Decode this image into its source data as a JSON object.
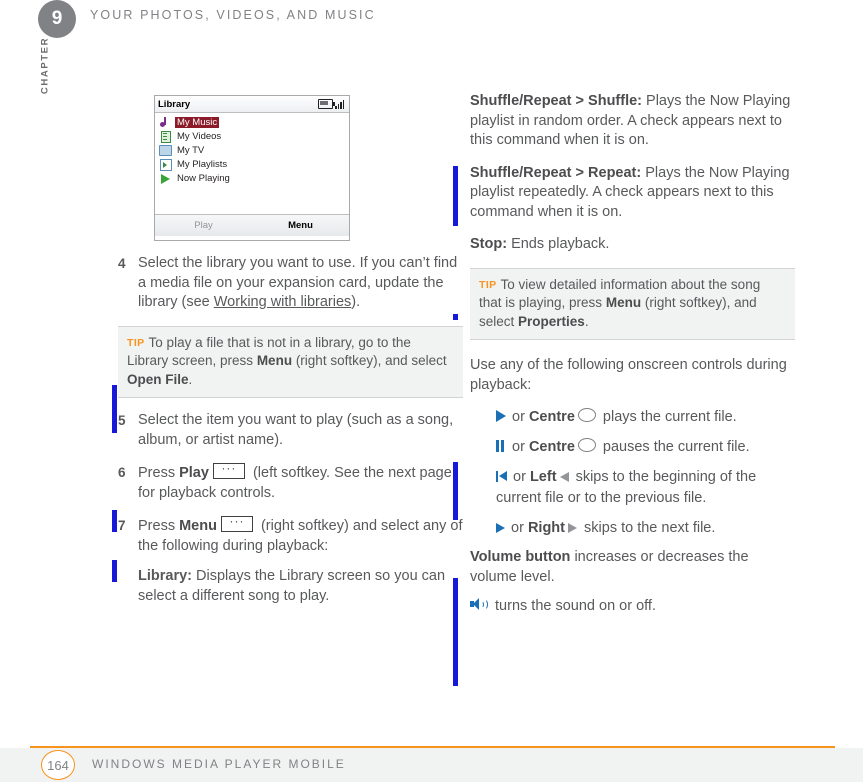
{
  "header": {
    "chapter_number": "9",
    "title": "YOUR PHOTOS, VIDEOS, AND MUSIC",
    "chapter_word": "CHAPTER"
  },
  "phone_screen": {
    "title": "Library",
    "status_icons": [
      "battery-icon",
      "signal-icon"
    ],
    "items": [
      {
        "label": "My Music",
        "icon": "music-note-icon",
        "selected": true
      },
      {
        "label": "My Videos",
        "icon": "video-icon",
        "selected": false
      },
      {
        "label": "My TV",
        "icon": "tv-icon",
        "selected": false
      },
      {
        "label": "My Playlists",
        "icon": "playlist-icon",
        "selected": false
      },
      {
        "label": "Now Playing",
        "icon": "play-icon",
        "selected": false
      }
    ],
    "softkey_left": "Play",
    "softkey_right": "Menu"
  },
  "left_column": {
    "step4": {
      "num": "4",
      "t1": "Select the library you want to use. If you can’t find a media file on your expansion card, update the library (see ",
      "link": "Working with libraries",
      "t2": ")."
    },
    "tip1": {
      "label": "TIP",
      "t1": "To play a file that is not in a library, go to the Library screen, press ",
      "b1": "Menu",
      "t2": " (right softkey), and select ",
      "b2": "Open File",
      "t3": "."
    },
    "step5": {
      "num": "5",
      "t1": "Select the item you want to play (such as a song, album, or artist name)."
    },
    "step6": {
      "num": "6",
      "t1": "Press ",
      "b1": "Play",
      "t2": " (left softkey. See the next page for playback controls."
    },
    "step7": {
      "num": "7",
      "t1": "Press ",
      "b1": "Menu",
      "t2": " (right softkey) and select any of the following during playback:"
    },
    "library_item": {
      "b1": "Library:",
      "t1": " Displays the Library screen so you can select a different song to play."
    }
  },
  "right_column": {
    "shuffle": {
      "b1": "Shuffle/Repeat > Shuffle:",
      "t1": " Plays the Now Playing playlist in random order. A check appears next to this command when it is on."
    },
    "repeat": {
      "b1": "Shuffle/Repeat > Repeat:",
      "t1": " Plays the Now Playing playlist repeatedly. A check appears next to this command when it is on."
    },
    "stop": {
      "b1": "Stop:",
      "t1": " Ends playback."
    },
    "tip2": {
      "label": "TIP",
      "t1": "To view detailed information about the song that is playing, press ",
      "b1": "Menu",
      "t2": " (right softkey), and select ",
      "b2": "Properties",
      "t3": "."
    },
    "intro": "Use any of the following onscreen controls during playback:",
    "controls": [
      {
        "icon": "play-icon",
        "t1": " or ",
        "b1": "Centre",
        "t2": " plays the current file."
      },
      {
        "icon": "pause-icon",
        "t1": " or ",
        "b1": "Centre",
        "t2": " pauses the current file."
      },
      {
        "icon": "skip-previous-icon",
        "t1": " or ",
        "b1": "Left",
        "t2": " skips to the beginning of the current file or to the previous file."
      },
      {
        "icon": "skip-next-icon",
        "t1": " or ",
        "b1": "Right",
        "t2": " skips to the next file."
      }
    ],
    "volume": {
      "b1": "Volume button",
      "t1": " increases or decreases the volume level."
    },
    "mute": {
      "icon": "speaker-icon",
      "t1": " turns the sound on or off."
    }
  },
  "footer": {
    "page_number": "164",
    "title": "WINDOWS MEDIA PLAYER MOBILE"
  },
  "colors": {
    "accent_orange": "#f7941e",
    "change_bar_blue": "#1818d8",
    "control_blue": "#1a6fb5",
    "selection_red": "#8c1b2a"
  }
}
